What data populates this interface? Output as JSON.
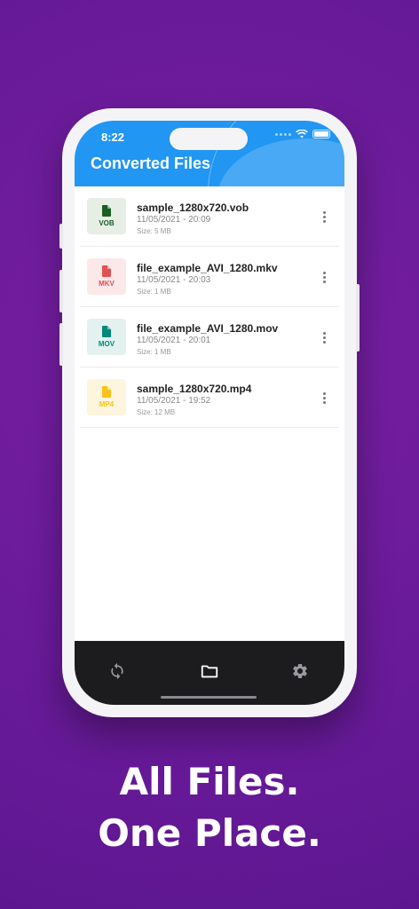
{
  "status": {
    "time": "8:22"
  },
  "header": {
    "title": "Converted Files"
  },
  "files": [
    {
      "name": "sample_1280x720.vob",
      "date": "11/05/2021 - 20:09",
      "size": "Size: 5 MB",
      "ext": "VOB",
      "color": "#1b5e20",
      "bg": "#e6eee6",
      "icon": "file-icon"
    },
    {
      "name": "file_example_AVI_1280.mkv",
      "date": "11/05/2021 - 20:03",
      "size": "Size: 1 MB",
      "ext": "MKV",
      "color": "#e05252",
      "bg": "#fbe9e9",
      "icon": "file-icon"
    },
    {
      "name": "file_example_AVI_1280.mov",
      "date": "11/05/2021 - 20:01",
      "size": "Size: 1 MB",
      "ext": "MOV",
      "color": "#00897b",
      "bg": "#e3f1ef",
      "icon": "file-icon"
    },
    {
      "name": "sample_1280x720.mp4",
      "date": "11/05/2021 - 19:52",
      "size": "Size: 12 MB",
      "ext": "MP4",
      "color": "#f9c21b",
      "bg": "#fdf5dd",
      "icon": "file-icon"
    }
  ],
  "tabbar": {
    "items": [
      {
        "icon": "sync-icon"
      },
      {
        "icon": "folder-icon",
        "active": true
      },
      {
        "icon": "gear-icon"
      }
    ]
  },
  "tagline": {
    "line1": "All Files.",
    "line2": "One Place."
  }
}
